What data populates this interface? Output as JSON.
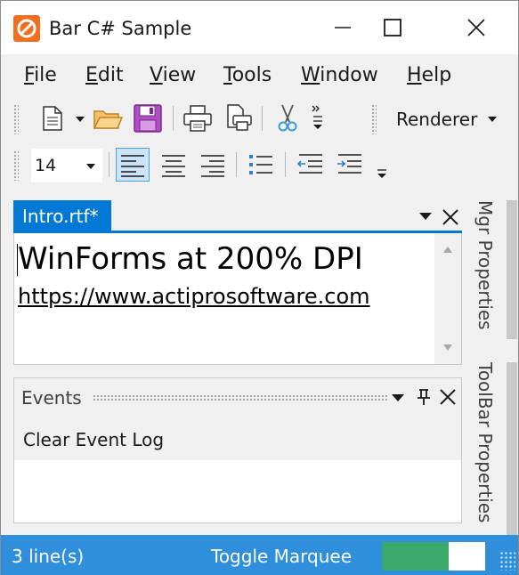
{
  "window": {
    "title": "Bar C# Sample",
    "icon": "app-logo-icon",
    "controls": [
      "minimize-icon",
      "maximize-icon",
      "close-icon"
    ]
  },
  "menubar": {
    "items": [
      {
        "label": "File",
        "accel": "F"
      },
      {
        "label": "Edit",
        "accel": "E"
      },
      {
        "label": "View",
        "accel": "V"
      },
      {
        "label": "Tools",
        "accel": "T"
      },
      {
        "label": "Window",
        "accel": "W"
      },
      {
        "label": "Help",
        "accel": "H"
      }
    ]
  },
  "toolbar1": {
    "icons": [
      "new-document-icon",
      "dropdown-arrow-icon",
      "open-folder-icon",
      "save-icon",
      "print-icon",
      "print-preview-icon",
      "cut-icon",
      "overflow-icon"
    ],
    "renderer_label": "Renderer"
  },
  "toolbar2": {
    "font_size": "14",
    "icons": [
      "align-left-icon",
      "align-center-icon",
      "align-right-icon",
      "bullets-icon",
      "outdent-icon",
      "indent-icon",
      "overflow-icon"
    ]
  },
  "document": {
    "tab_label": "Intro.rtf*",
    "line1": "WinForms at 200% DPI",
    "line2": "https://www.actiprosoftware.com"
  },
  "events_panel": {
    "title": "Events",
    "clear_label": "Clear Event Log"
  },
  "side_tabs": [
    "Mgr Properties",
    "ToolBar Properties"
  ],
  "statusbar": {
    "line_count": "3 line(s)",
    "marquee_label": "Toggle Marquee",
    "progress_fraction": 0.65
  },
  "colors": {
    "accent": "#0078d4",
    "status_bg": "#2f8fdc",
    "progress": "#3aa96a",
    "app_icon": "#f26f1f"
  }
}
